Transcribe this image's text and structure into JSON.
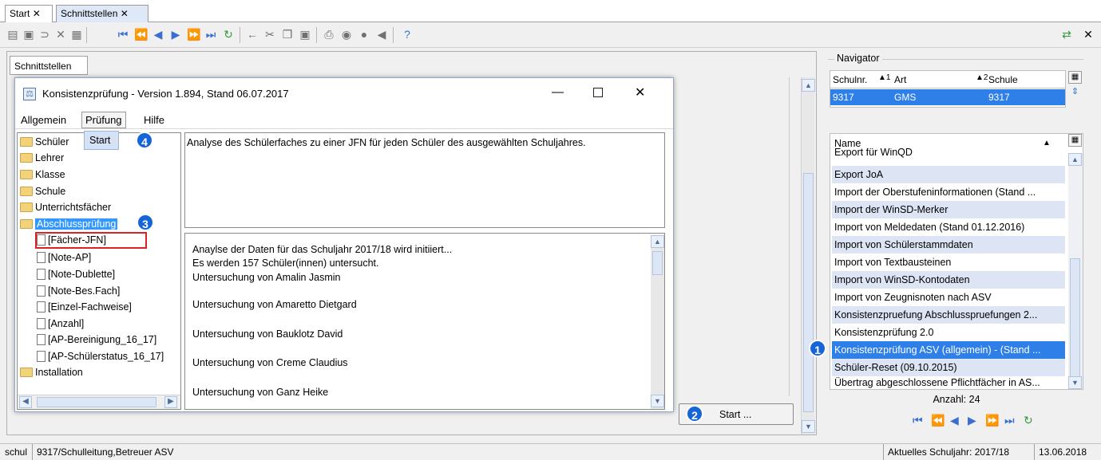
{
  "tabs": [
    {
      "label": "Start"
    },
    {
      "label": "Schnittstellen"
    }
  ],
  "subtab": "Schnittstellen",
  "dialog": {
    "title": "Konsistenzprüfung - Version 1.894, Stand 06.07.2017",
    "menu": [
      "Allgemein",
      "Prüfung",
      "Hilfe"
    ],
    "dropdown_item": "Start",
    "tree": [
      {
        "label": "Schüler",
        "kind": "folder"
      },
      {
        "label": "Lehrer",
        "kind": "folder"
      },
      {
        "label": "Klasse",
        "kind": "folder"
      },
      {
        "label": "Schule",
        "kind": "folder"
      },
      {
        "label": "Unterrichtsfächer",
        "kind": "folder"
      },
      {
        "label": "Abschlussprüfung",
        "kind": "folder"
      },
      {
        "label": "[Fächer-JFN]",
        "kind": "doc"
      },
      {
        "label": "[Note-AP]",
        "kind": "doc"
      },
      {
        "label": "[Note-Dublette]",
        "kind": "doc"
      },
      {
        "label": "[Note-Bes.Fach]",
        "kind": "doc"
      },
      {
        "label": "[Einzel-Fachweise]",
        "kind": "doc"
      },
      {
        "label": "[Anzahl]",
        "kind": "doc"
      },
      {
        "label": "[AP-Bereinigung_16_17]",
        "kind": "doc"
      },
      {
        "label": "[AP-Schülerstatus_16_17]",
        "kind": "doc"
      },
      {
        "label": "Installation",
        "kind": "folder"
      }
    ],
    "description": "Analyse des Schülerfaches zu einer JFN für jeden Schüler des ausgewählten Schuljahres.",
    "log": [
      "Anaylse der Daten für das Schuljahr 2017/18 wird initiiert...",
      "Es werden 157 Schüler(innen) untersucht.",
      " Untersuchung von Amalin Jasmin",
      " Untersuchung von Amaretto Dietgard",
      " Untersuchung von Bauklotz David",
      " Untersuchung von Creme Claudius",
      " Untersuchung von Ganz Heike"
    ]
  },
  "badges": {
    "one": "1",
    "two": "2",
    "three": "3",
    "four": "4"
  },
  "start_button": "Start ...",
  "navigator": {
    "legend": "Navigator",
    "columns": [
      {
        "label": "Schulnr.",
        "sort": "1"
      },
      {
        "label": "Art",
        "sort": "2"
      },
      {
        "label": "Schule",
        "sort": ""
      }
    ],
    "row": {
      "schulnr": "9317",
      "art": "GMS",
      "schule": "9317"
    },
    "name_header": "Name",
    "names": [
      "Export für WinQD",
      "Export JoA",
      "Import der Oberstufeninformationen (Stand ...",
      "Import der WinSD-Merker",
      "Import von Meldedaten (Stand 01.12.2016)",
      "Import von Schülerstammdaten",
      "Import von Textbausteinen",
      "Import von WinSD-Kontodaten",
      "Import von Zeugnisnoten nach ASV",
      "Konsistenzpruefung Abschlusspruefungen 2...",
      "Konsistenzprüfung 2.0",
      "Konsistenzprüfung ASV (allgemein) - (Stand ...",
      "Schüler-Reset (09.10.2015)",
      "Übertrag abgeschlossene Pflichtfächer in AS..."
    ],
    "count": "Anzahl: 24"
  },
  "status": {
    "left": "schul",
    "user": "9317/Schulleitung,Betreuer ASV",
    "year": "Aktuelles Schuljahr: 2017/18",
    "date": "13.06.2018"
  },
  "icons": [
    "save-icon",
    "undo-icon",
    "delete-icon",
    "first-icon",
    "prev-page-icon",
    "prev-icon",
    "next-icon",
    "next-page-icon",
    "last-icon",
    "refresh-icon",
    "cut-icon",
    "copy-icon",
    "paste-icon",
    "print-icon",
    "help-icon",
    "close-icon"
  ]
}
